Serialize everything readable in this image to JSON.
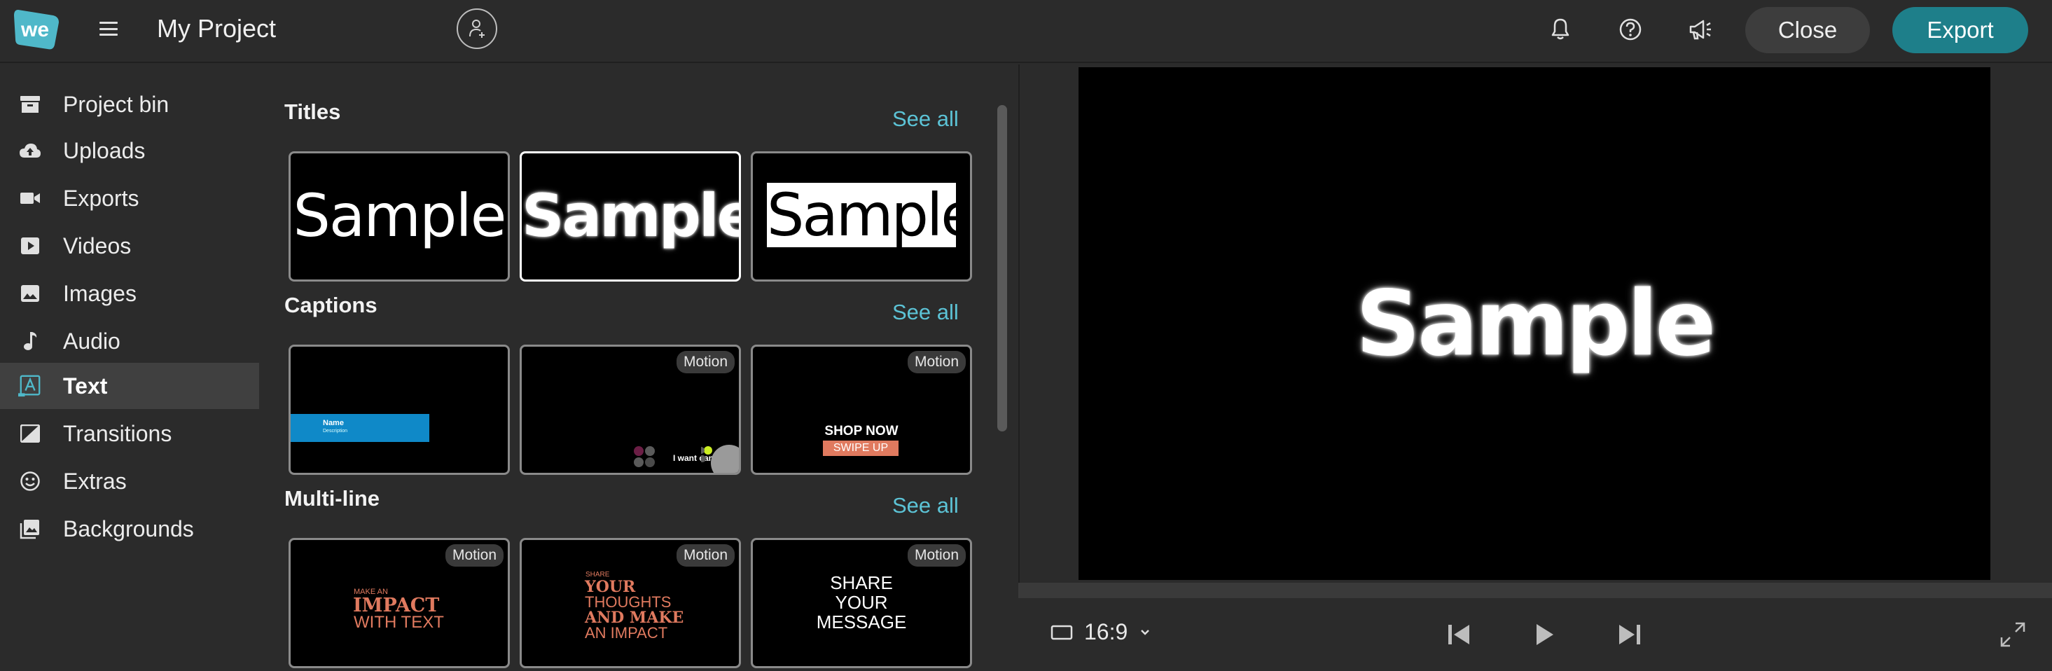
{
  "header": {
    "logo_text": "we",
    "project_title": "My Project",
    "close_label": "Close",
    "export_label": "Export",
    "accent_color": "#1e7f8a"
  },
  "sidebar": {
    "items": [
      {
        "label": "Project bin",
        "icon": "archive-icon"
      },
      {
        "label": "Uploads",
        "icon": "cloud-upload-icon"
      },
      {
        "label": "Exports",
        "icon": "video-camera-icon"
      },
      {
        "label": "Videos",
        "icon": "play-box-icon"
      },
      {
        "label": "Images",
        "icon": "image-icon"
      },
      {
        "label": "Audio",
        "icon": "music-note-icon"
      },
      {
        "label": "Text",
        "icon": "text-icon",
        "active": true
      },
      {
        "label": "Transitions",
        "icon": "transition-icon"
      },
      {
        "label": "Extras",
        "icon": "smiley-icon"
      },
      {
        "label": "Backgrounds",
        "icon": "backgrounds-icon"
      }
    ]
  },
  "content": {
    "see_all_label": "See all",
    "motion_label": "Motion",
    "sections": {
      "titles": {
        "title": "Titles",
        "cards": [
          {
            "text": "Sample",
            "style": "plain"
          },
          {
            "text": "Sample",
            "style": "glow",
            "selected": true
          },
          {
            "text": "Sample",
            "style": "boxed"
          }
        ]
      },
      "captions": {
        "title": "Captions",
        "cards": [
          {
            "name_text": "Name",
            "desc_text": "Description"
          },
          {
            "text": "I want candy",
            "motion": true
          },
          {
            "line1": "SHOP NOW",
            "line2": "SWIPE UP",
            "motion": true
          }
        ]
      },
      "multiline": {
        "title": "Multi-line",
        "cards": [
          {
            "small": "MAKE AN",
            "big": "IMPACT",
            "tail": "WITH TEXT",
            "motion": true
          },
          {
            "small": "SHARE",
            "l1": "YOUR",
            "l2": "THOUGHTS",
            "l3": "AND MAKE",
            "l4": "AN IMPACT",
            "motion": true
          },
          {
            "l1": "SHARE",
            "l2": "YOUR",
            "l3": "MESSAGE",
            "motion": true
          }
        ]
      }
    }
  },
  "preview": {
    "sample_text": "Sample",
    "aspect_ratio": "16:9"
  }
}
